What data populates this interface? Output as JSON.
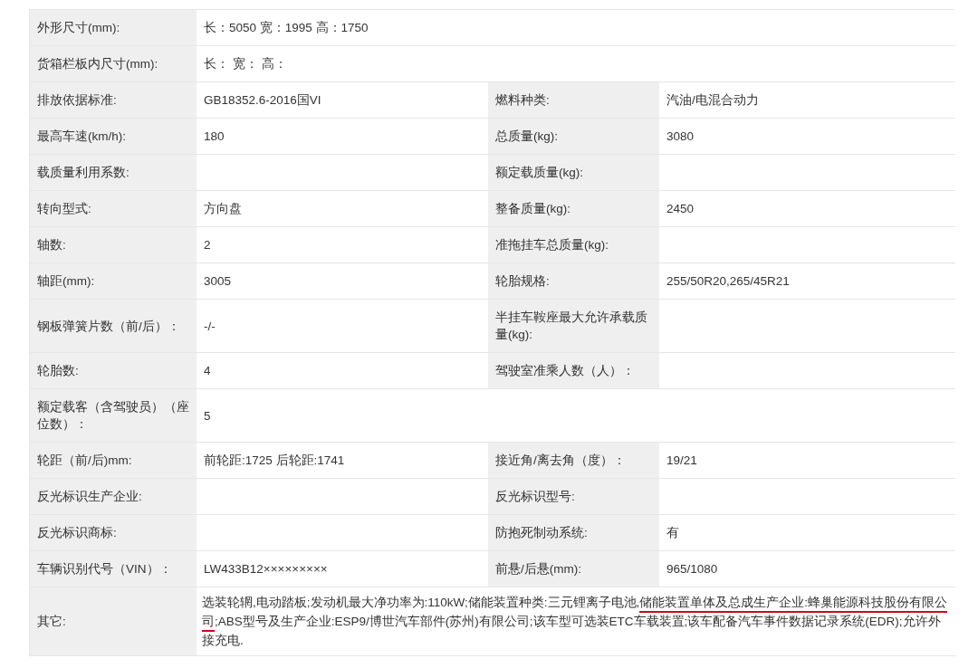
{
  "rows": [
    {
      "kind": "single",
      "label": "外形尺寸(mm):",
      "value": "长：5050 宽：1995 高：1750"
    },
    {
      "kind": "single",
      "label": "货箱栏板内尺寸(mm):",
      "value": "长：  宽：  高："
    },
    {
      "kind": "pair",
      "label": "排放依据标准:",
      "value": "GB18352.6-2016国VI",
      "label2": "燃料种类:",
      "value2": "汽油/电混合动力"
    },
    {
      "kind": "pair",
      "label": "最高车速(km/h):",
      "value": "180",
      "label2": "总质量(kg):",
      "value2": "3080"
    },
    {
      "kind": "pair",
      "label": "载质量利用系数:",
      "label2": "额定载质量(kg):"
    },
    {
      "kind": "pair",
      "label": "转向型式:",
      "value": "方向盘",
      "label2": "整备质量(kg):",
      "value2": "2450"
    },
    {
      "kind": "pair",
      "label": "轴数:",
      "value": "2",
      "label2": "准拖挂车总质量(kg):"
    },
    {
      "kind": "pair",
      "label": "轴距(mm):",
      "value": "3005",
      "label2": "轮胎规格:",
      "value2": "255/50R20,265/45R21"
    },
    {
      "kind": "pair",
      "label": "钢板弹簧片数（前/后）：",
      "value": "-/-",
      "label2": "半挂车鞍座最大允许承载质量(kg):"
    },
    {
      "kind": "pair",
      "label": "轮胎数:",
      "value": "4",
      "label2": "驾驶室准乘人数（人）："
    },
    {
      "kind": "single",
      "label": "额定载客（含驾驶员）（座位数）：",
      "value": "5"
    },
    {
      "kind": "pair",
      "label": "轮距（前/后)mm:",
      "value": "前轮距:1725 后轮距:1741",
      "label2": "接近角/离去角（度）：",
      "value2": "19/21"
    },
    {
      "kind": "pair",
      "label": "反光标识生产企业:",
      "label2": "反光标识型号:"
    },
    {
      "kind": "pair",
      "label": "反光标识商标:",
      "label2": "防抱死制动系统:",
      "value2": "有"
    },
    {
      "kind": "pair",
      "label": "车辆识别代号（VIN）：",
      "value": "LW433B12×××××××××",
      "label2": "前悬/后悬(mm):",
      "value2": "965/1080"
    },
    {
      "kind": "segments",
      "label": "其它:",
      "segments": [
        {
          "text": "选装轮辋,电动踏板;发动机最大净功率为:110kW;储能装置种类:三元锂离子电池,",
          "underlined": false
        },
        {
          "text": "储能装置单体及总成生产企业:蜂巢能源科技股份有限公司",
          "underlined": true
        },
        {
          "text": ";ABS型号及生产企业:ESP9/博世汽车部件(苏州)有限公司;该车型可选装ETC车载装置;该车配备汽车事件数据记录系统(EDR);允许外接充电.",
          "underlined": false
        }
      ]
    }
  ]
}
